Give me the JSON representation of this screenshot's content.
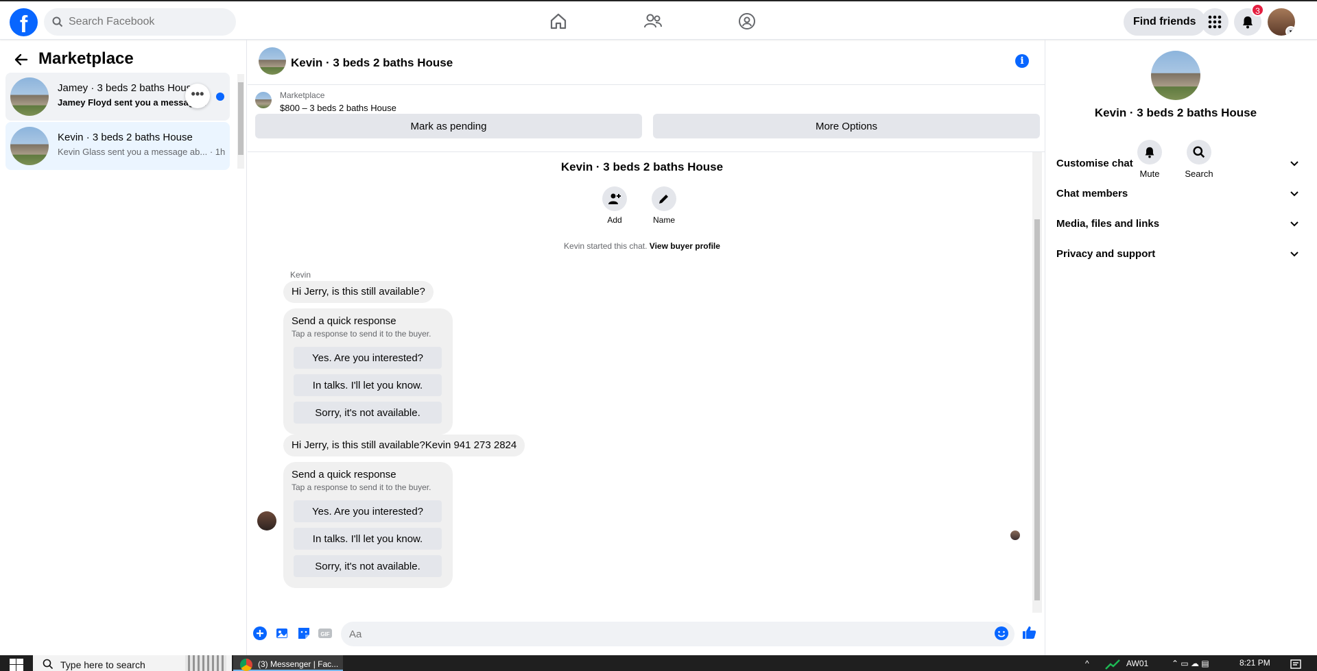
{
  "topbar": {
    "logo": "f",
    "search_placeholder": "Search Facebook",
    "find_friends": "Find friends",
    "notification_count": "3"
  },
  "left": {
    "title": "Marketplace",
    "conversations": [
      {
        "name": "Jamey · 3 beds 2 baths House",
        "preview": "Jamey Floyd sent you a message...",
        "unread": true
      },
      {
        "name": "Kevin · 3 beds 2 baths House",
        "preview": "Kevin Glass sent you a message ab... · 1h",
        "unread": false
      }
    ]
  },
  "chat": {
    "title": "Kevin · 3 beds 2 baths House",
    "source": "Marketplace",
    "listing": "$800 – 3 beds 2 baths House",
    "mark_pending": "Mark as pending",
    "more_options": "More Options",
    "conversation_title": "Kevin · 3 beds 2 baths House",
    "actions": {
      "add": "Add",
      "name": "Name"
    },
    "started_text": "Kevin started this chat.",
    "view_profile": "View buyer profile",
    "sender": "Kevin",
    "msg1": "Hi Jerry, is this still available?",
    "msg2": "Hi Jerry, is this still available?Kevin 941 273 2824",
    "quick_title": "Send a quick response",
    "quick_sub": "Tap a response to send it to the buyer.",
    "quick_options": [
      "Yes. Are you interested?",
      "In talks. I'll let you know.",
      "Sorry, it's not available."
    ],
    "composer_placeholder": "Aa"
  },
  "right": {
    "title": "Kevin · 3 beds 2 baths House",
    "mute": "Mute",
    "search": "Search",
    "sections": [
      "Customise chat",
      "Chat members",
      "Media, files and links",
      "Privacy and support"
    ]
  },
  "taskbar": {
    "search_placeholder": "Type here to search",
    "app": "(3) Messenger | Fac...",
    "network": "AW01",
    "time": "8:21 PM"
  },
  "colors": {
    "brand": "#0866ff",
    "badge": "#e41e3f"
  }
}
